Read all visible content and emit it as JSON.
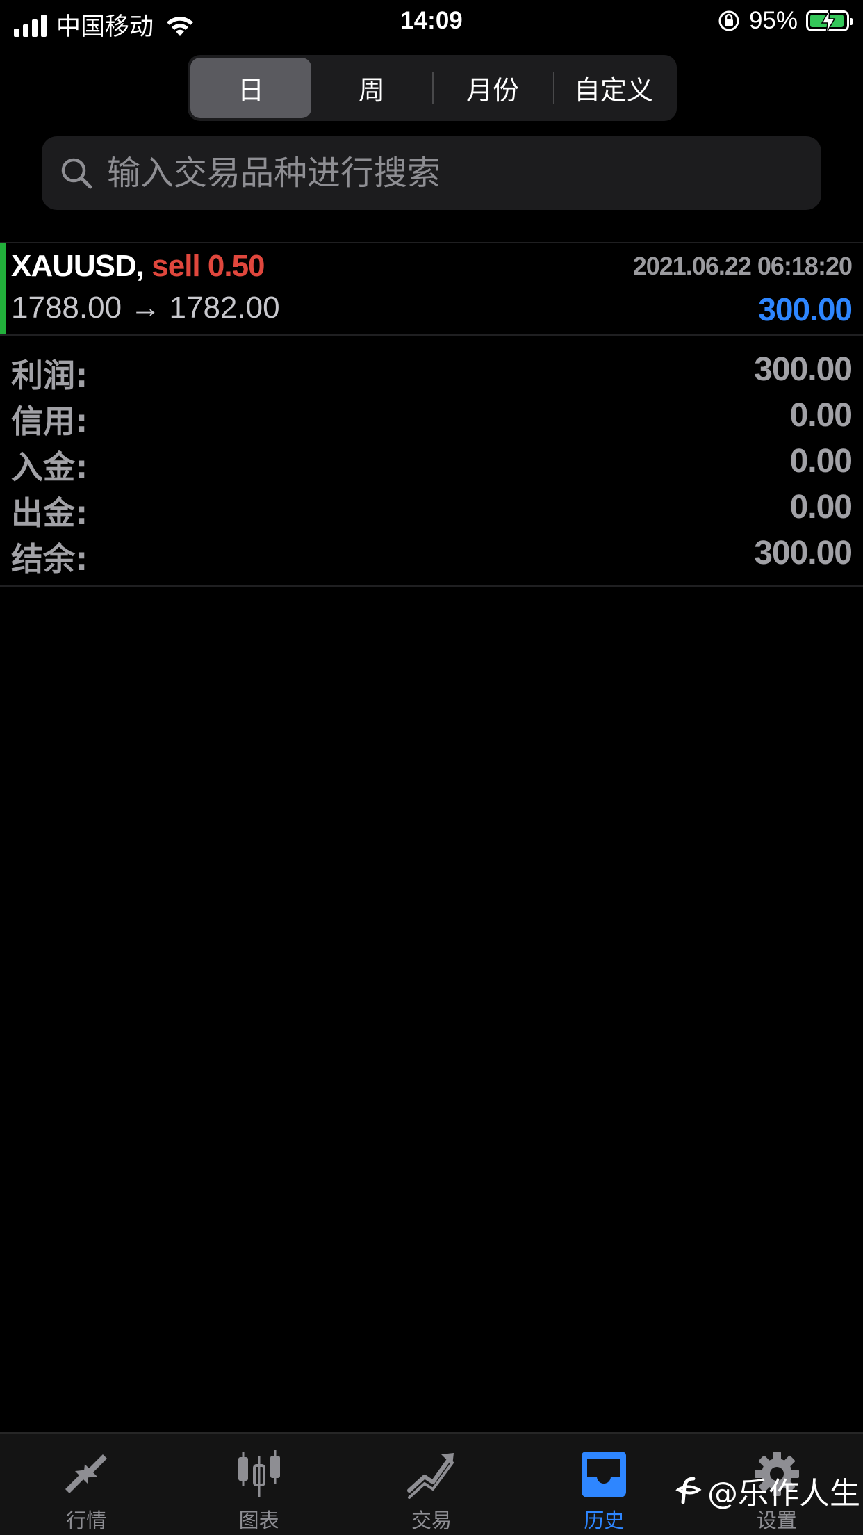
{
  "status_bar": {
    "carrier": "中国移动",
    "time": "14:09",
    "battery": "95%"
  },
  "period_tabs": [
    {
      "label": "日",
      "active": true
    },
    {
      "label": "周",
      "active": false
    },
    {
      "label": "月份",
      "active": false
    },
    {
      "label": "自定义",
      "active": false
    }
  ],
  "search": {
    "placeholder": "输入交易品种进行搜索",
    "value": ""
  },
  "trade": {
    "symbol": "XAUUSD,",
    "side": "sell 0.50",
    "time": "2021.06.22 06:18:20",
    "prices": "1788.00 → 1782.00",
    "profit": "300.00"
  },
  "summary": [
    {
      "label": "利润:",
      "value": "300.00"
    },
    {
      "label": "信用:",
      "value": "0.00"
    },
    {
      "label": "入金:",
      "value": "0.00"
    },
    {
      "label": "出金:",
      "value": "0.00"
    },
    {
      "label": "结余:",
      "value": "300.00"
    }
  ],
  "tab_bar": [
    {
      "label": "行情",
      "icon": "quotes-arrows-icon",
      "active": false
    },
    {
      "label": "图表",
      "icon": "candlestick-chart-icon",
      "active": false
    },
    {
      "label": "交易",
      "icon": "trade-trend-icon",
      "active": false
    },
    {
      "label": "历史",
      "icon": "history-inbox-icon",
      "active": true
    },
    {
      "label": "设置",
      "icon": "gear-icon",
      "active": false
    }
  ],
  "watermark": "@乐作人生",
  "colors": {
    "background": "#000000",
    "accent_blue": "#2e86ff",
    "sell_red": "#e0473d",
    "trade_bar_green": "#22b03b"
  }
}
